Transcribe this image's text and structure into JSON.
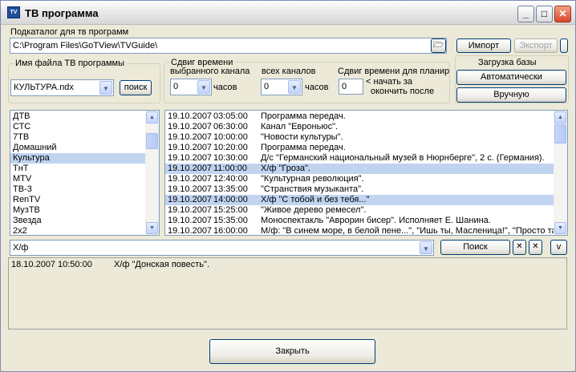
{
  "window": {
    "title": "ТВ программа",
    "icon_text": "TV",
    "controls": {
      "minimize": "_",
      "maximize": "□",
      "close": "✕"
    }
  },
  "subdir": {
    "label": "Подкаталог для тв программ",
    "path": "C:\\Program Files\\GoTView\\TVGuide\\",
    "import_label": "Импорт",
    "export_label": "Экспорт"
  },
  "db_load": {
    "title": "Загрузка базы",
    "auto_label": "Автоматически",
    "manual_label": "Вручную"
  },
  "file": {
    "label": "Имя файла ТВ программы",
    "value": "КУЛЬТУРА.ndx",
    "search_label": "поиск"
  },
  "time_shift": {
    "title": "Сдвиг времени",
    "selected_label": "выбранного канала",
    "selected_value": "0",
    "selected_unit": "часов",
    "all_label": "всех каналов",
    "all_value": "0",
    "all_unit": "часов",
    "plan_label": "Сдвиг времени для планир",
    "plan_value": "0",
    "plan_note_1": "< начать за",
    "plan_note_2": "окончить после"
  },
  "channels": [
    {
      "name": "ДТВ"
    },
    {
      "name": "СТС"
    },
    {
      "name": "7ТВ"
    },
    {
      "name": "Домашний"
    },
    {
      "name": "Культура",
      "selected": true
    },
    {
      "name": "ТнТ"
    },
    {
      "name": "MTV"
    },
    {
      "name": "ТВ-3"
    },
    {
      "name": "RenTV"
    },
    {
      "name": "МузТВ"
    },
    {
      "name": "Звезда"
    },
    {
      "name": "2x2"
    }
  ],
  "programs": [
    {
      "date": "19.10.2007",
      "time": "03:05:00",
      "name": "Программа передач."
    },
    {
      "date": "19.10.2007",
      "time": "06:30:00",
      "name": "Канал \"Евроньюс\"."
    },
    {
      "date": "19.10.2007",
      "time": "10:00:00",
      "name": "\"Новости культуры\"."
    },
    {
      "date": "19.10.2007",
      "time": "10:20:00",
      "name": "Программа передач."
    },
    {
      "date": "19.10.2007",
      "time": "10:30:00",
      "name": "Д/с \"Германский национальный музей в Нюрнберге\", 2 с. (Германия)."
    },
    {
      "date": "19.10.2007",
      "time": "11:00:00",
      "name": "Х/ф \"Гроза\".",
      "selected": true
    },
    {
      "date": "19.10.2007",
      "time": "12:40:00",
      "name": "\"Культурная революция\"."
    },
    {
      "date": "19.10.2007",
      "time": "13:35:00",
      "name": "\"Странствия музыканта\"."
    },
    {
      "date": "19.10.2007",
      "time": "14:00:00",
      "name": "Х/ф \"С тобой и без тебя...\"",
      "selected": true
    },
    {
      "date": "19.10.2007",
      "time": "15:25:00",
      "name": "\"Живое дерево ремесел\"."
    },
    {
      "date": "19.10.2007",
      "time": "15:35:00",
      "name": "Моноспектакль \"Аврорин бисер\". Исполняет Е. Шанина."
    },
    {
      "date": "19.10.2007",
      "time": "16:00:00",
      "name": "М/ф: \"В синем море, в белой пене...\", \"Ишь ты, Масленица!\", \"Просто так\""
    }
  ],
  "search": {
    "value": "Х/ф",
    "button_label": "Поиск",
    "clear_1": "✕",
    "clear_2": "✕",
    "down_label": "v"
  },
  "results": [
    {
      "date": "18.10.2007",
      "time": "10:50:00",
      "name": "Х/ф \"Донская повесть\"."
    }
  ],
  "close_label": "Закрыть",
  "glyphs": {
    "dropdown": "▼",
    "up": "▲",
    "down": "▼"
  }
}
